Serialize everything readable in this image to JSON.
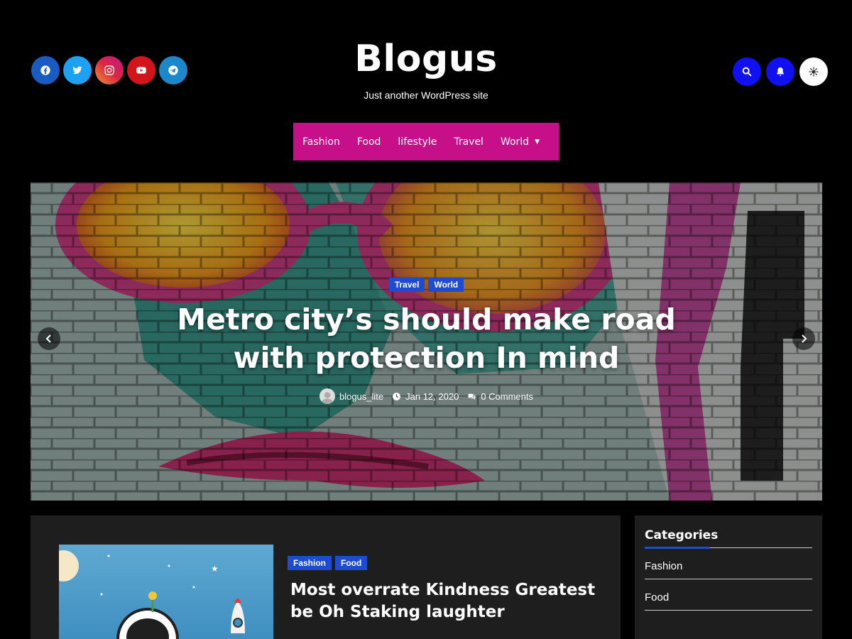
{
  "header": {
    "site_title": "Blogus",
    "tagline": "Just another WordPress site",
    "social": [
      {
        "icon": "facebook-icon",
        "color": "#1a5bc2"
      },
      {
        "icon": "twitter-icon",
        "color": "#1da1f2"
      },
      {
        "icon": "instagram-icon",
        "color": "#d6249f"
      },
      {
        "icon": "youtube-icon",
        "color": "#d1151a"
      },
      {
        "icon": "telegram-icon",
        "color": "#1c88c9"
      }
    ],
    "actions": [
      {
        "icon": "search-icon",
        "color": "#1010f0"
      },
      {
        "icon": "bell-icon",
        "color": "#1010f0"
      },
      {
        "icon": "theme-toggle-icon",
        "color": "#ffffff"
      }
    ]
  },
  "nav": {
    "items": [
      "Fashion",
      "Food",
      "lifestyle",
      "Travel",
      "World"
    ],
    "accent": "#c60f88"
  },
  "hero": {
    "categories": [
      "Travel",
      "World"
    ],
    "title": "Metro city’s should make road with protection In mind",
    "author": "blogus_lite",
    "date": "Jan 12, 2020",
    "comments": "0 Comments"
  },
  "post": {
    "categories": [
      "Fashion",
      "Food"
    ],
    "title": "Most overrate Kindness Greatest be Oh Staking laughter"
  },
  "sidebar": {
    "title": "Categories",
    "categories": [
      "Fashion",
      "Food"
    ]
  },
  "colors": {
    "badge": "#1d4cd1",
    "card_bg": "#1e1e1e"
  }
}
